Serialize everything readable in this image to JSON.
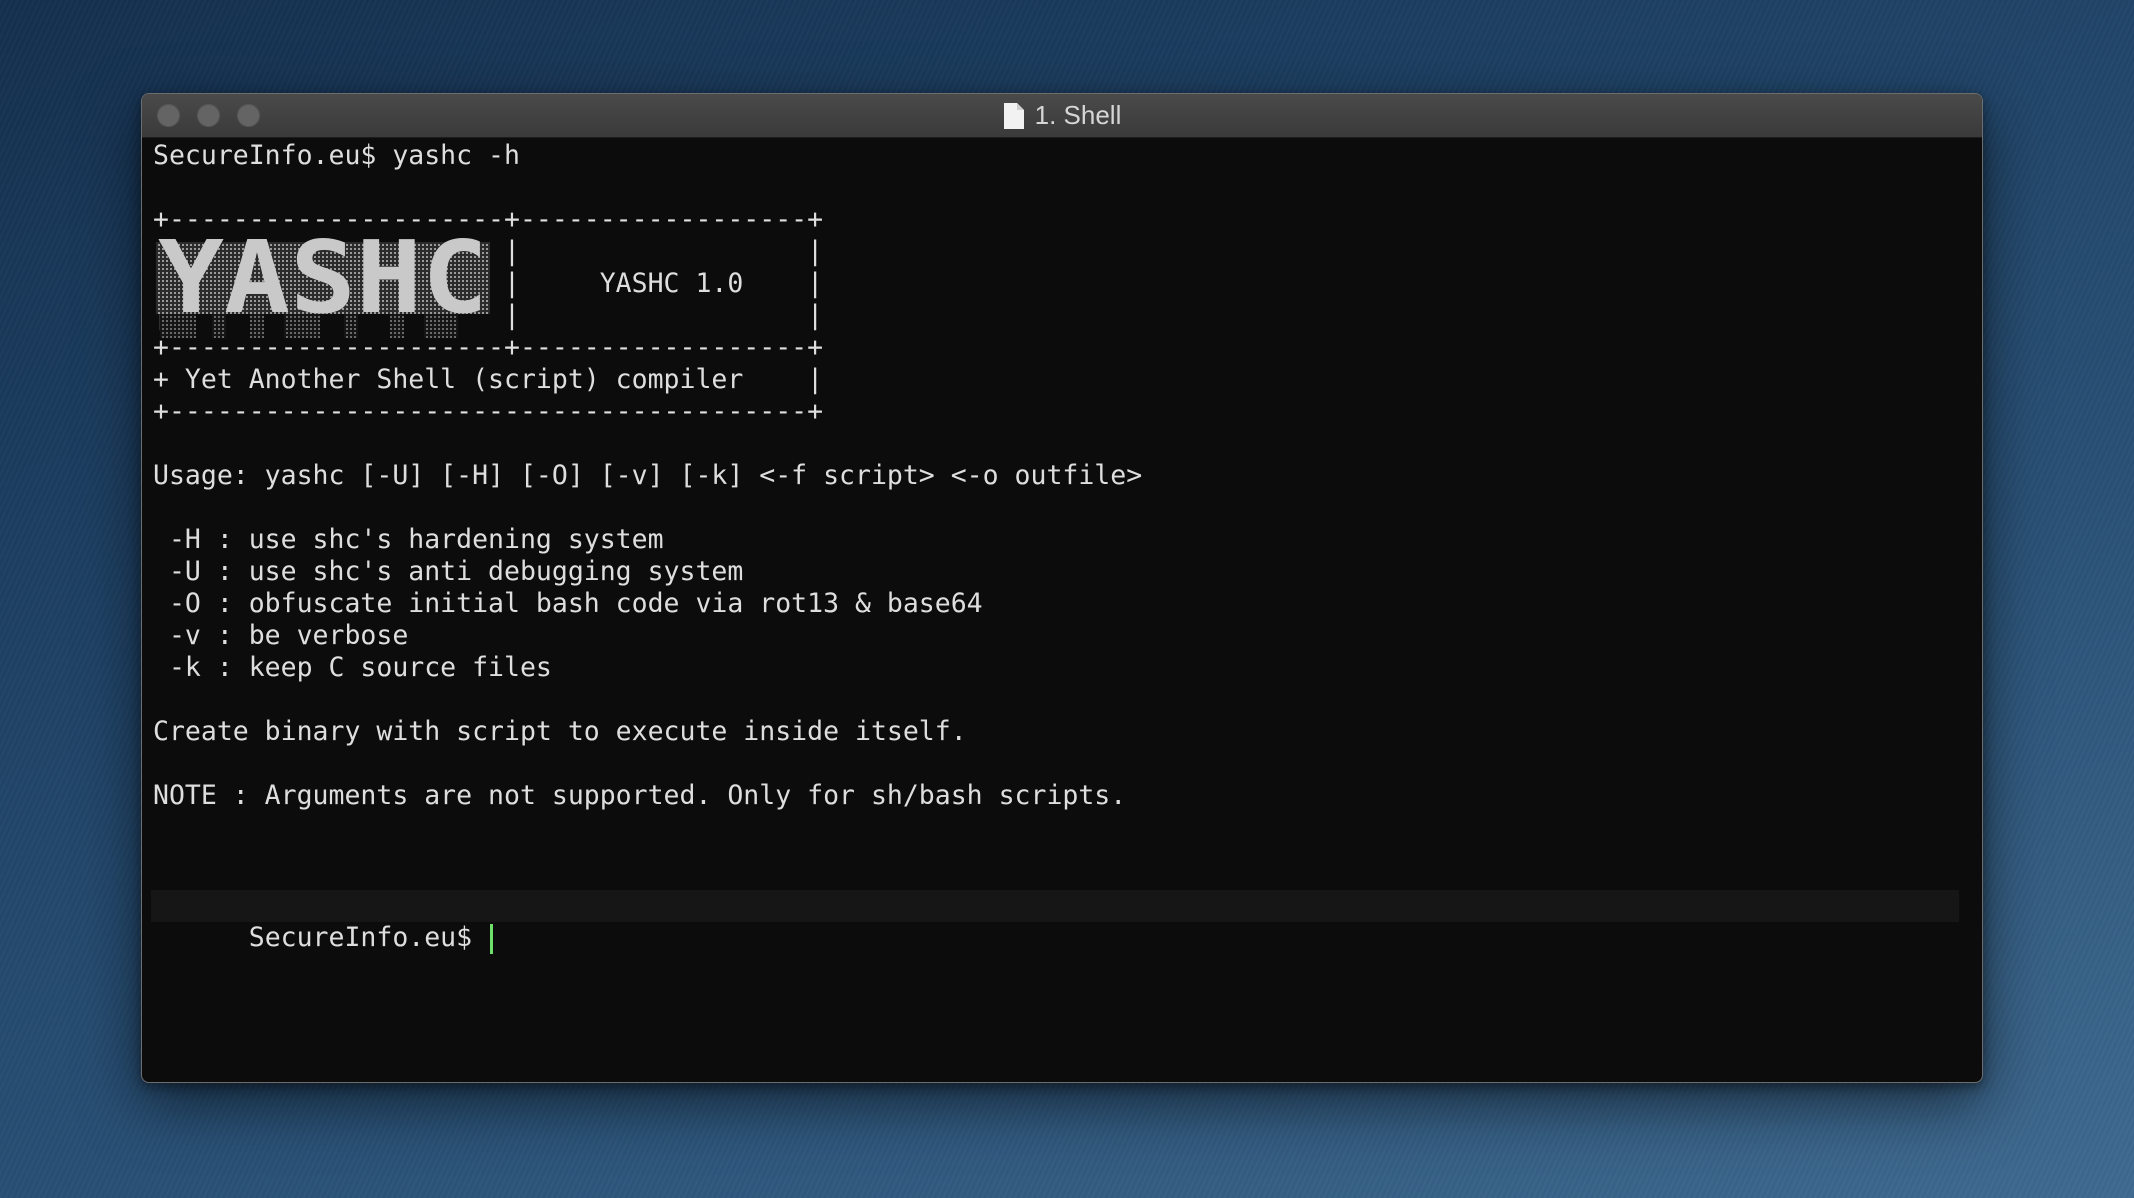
{
  "window": {
    "title": "1. Shell"
  },
  "terminal": {
    "lines": [
      "SecureInfo.eu$ yashc -h",
      "",
      "+---------------------+------------------+",
      "|                     |                  |",
      "|                     |     YASHC 1.0    |",
      "|                     |                  |",
      "+---------------------+------------------+",
      "+ Yet Another Shell (script) compiler    |",
      "+----------------------------------------+",
      "",
      "Usage: yashc [-U] [-H] [-O] [-v] [-k] <-f script> <-o outfile>",
      "",
      " -H : use shc's hardening system",
      " -U : use shc's anti debugging system",
      " -O : obfuscate initial bash code via rot13 & base64",
      " -v : be verbose",
      " -k : keep C source files",
      "",
      "Create binary with script to execute inside itself.",
      "",
      "NOTE : Arguments are not supported. Only for sh/bash scripts.",
      ""
    ],
    "prompt": "SecureInfo.eu$ ",
    "ascii_logo_text": "YASHC",
    "colors": {
      "text": "#dedede",
      "cursor": "#6ee06a",
      "background": "#0c0c0c"
    }
  }
}
